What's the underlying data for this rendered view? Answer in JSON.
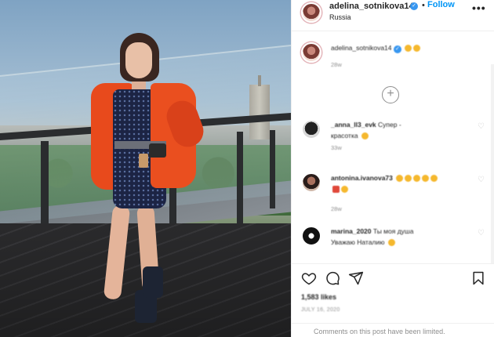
{
  "post": {
    "username": "adelina_sotnikova14",
    "follow_label": "Follow",
    "separator": "•",
    "location": "Russia",
    "more_label": "•••"
  },
  "comments": [
    {
      "user": "adelina_sotnikova14",
      "text": "",
      "time": "28w"
    },
    {
      "user": "_anna_ll3_evk",
      "text": "Супер -",
      "text2": "красотка",
      "time": "33w"
    },
    {
      "user": "antonina.ivanova73",
      "text": "",
      "time": "28w"
    },
    {
      "user": "marina_2020",
      "text": "Ты моя душа",
      "text2": "Уважаю Наталию",
      "time": ""
    }
  ],
  "load_more_label": "+",
  "icons": {
    "like": "heart-icon",
    "comment": "comment-icon",
    "share": "share-icon",
    "save": "bookmark-icon",
    "verified": "verified-badge-icon"
  },
  "stats": {
    "likes": "1,583 likes",
    "date": "JULY 16, 2020"
  },
  "notice": "Comments on this post have been limited.",
  "colors": {
    "follow": "#0095f6",
    "verified": "#3897f0",
    "jacket": "#e84a1c",
    "text": "#262626",
    "muted": "#8e8e8e"
  }
}
